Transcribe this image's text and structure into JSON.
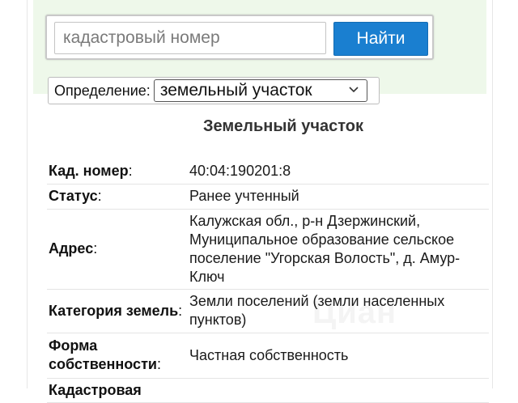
{
  "search": {
    "placeholder": "кадастровый номер",
    "button_label": "Найти"
  },
  "definition": {
    "label": "Определение:",
    "selected": "земельный участок"
  },
  "title": "Земельный участок",
  "rows": [
    {
      "key": "Кад. номер",
      "value": "40:04:190201:8"
    },
    {
      "key": "Статус",
      "value": "Ранее учтенный"
    },
    {
      "key": "Адрес",
      "value": "Калужская обл., р-н Дзержинский, Муниципальное образование сельское поселение \"Угорская Волость\", д. Амур-Ключ"
    },
    {
      "key": "Категория земель",
      "value": "Земли поселений (земли населенных пунктов)"
    },
    {
      "key": "Форма собственности",
      "value": "Частная собственность"
    },
    {
      "key": "Кадастровая",
      "value": ""
    }
  ],
  "watermark": "Циан",
  "colors": {
    "accent": "#1a7fd0",
    "map_band": "#eef8ea"
  },
  "icons": {
    "select_arrow": "chevron-down-icon"
  }
}
